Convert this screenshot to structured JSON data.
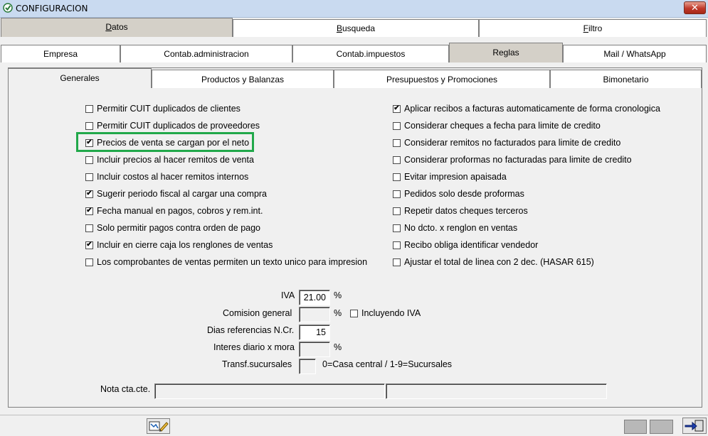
{
  "window": {
    "title": "CONFIGURACION",
    "close_glyph": "✕"
  },
  "tabs_row1": [
    {
      "label": "Datos",
      "accel": "D",
      "rest": "atos",
      "active": true
    },
    {
      "label": "Busqueda",
      "accel": "B",
      "rest": "usqueda",
      "active": false
    },
    {
      "label": "Filtro",
      "accel": "F",
      "rest": "iltro",
      "active": false
    }
  ],
  "tabs_row2": [
    {
      "label": "Empresa",
      "active": false
    },
    {
      "label": "Contab.administracion",
      "active": false
    },
    {
      "label": "Contab.impuestos",
      "active": false
    },
    {
      "label": "Reglas",
      "active": true
    },
    {
      "label": "Mail / WhatsApp",
      "active": false
    }
  ],
  "tabs_row3": [
    {
      "label": "Generales",
      "active": true
    },
    {
      "label": "Productos y Balanzas",
      "active": false
    },
    {
      "label": "Presupuestos y Promociones",
      "active": false
    },
    {
      "label": "Bimonetario",
      "active": false
    }
  ],
  "left_options": [
    {
      "label": "Permitir CUIT duplicados de clientes",
      "checked": false
    },
    {
      "label": "Permitir CUIT duplicados de proveedores",
      "checked": false
    },
    {
      "label": "Precios de venta se cargan por el neto",
      "checked": true
    },
    {
      "label": "Incluir precios al hacer remitos de venta",
      "checked": false
    },
    {
      "label": "Incluir costos al hacer remitos internos",
      "checked": false
    },
    {
      "label": "Sugerir periodo fiscal al cargar una compra",
      "checked": true
    },
    {
      "label": "Fecha manual en pagos, cobros y rem.int.",
      "checked": true
    },
    {
      "label": "Solo permitir pagos contra orden de pago",
      "checked": false
    },
    {
      "label": "Incluir en cierre caja los renglones de ventas",
      "checked": true
    },
    {
      "label": "Los comprobantes de ventas permiten un texto unico para impresion",
      "checked": false
    }
  ],
  "right_options": [
    {
      "label": "Aplicar recibos a facturas automaticamente de forma cronologica",
      "checked": true
    },
    {
      "label": "Considerar cheques a fecha para limite de credito",
      "checked": false
    },
    {
      "label": "Considerar remitos no facturados para limite de credito",
      "checked": false
    },
    {
      "label": "Considerar proformas no facturadas para limite de credito",
      "checked": false
    },
    {
      "label": "Evitar impresion apaisada",
      "checked": false
    },
    {
      "label": "Pedidos solo desde proformas",
      "checked": false
    },
    {
      "label": "Repetir datos cheques terceros",
      "checked": false
    },
    {
      "label": "No dcto. x renglon en ventas",
      "checked": false
    },
    {
      "label": "Recibo obliga identificar vendedor",
      "checked": false
    },
    {
      "label": "Ajustar el total de linea con 2 dec. (HASAR 615)",
      "checked": false
    }
  ],
  "fields": {
    "iva_label": "IVA",
    "iva_value": "21.00",
    "iva_unit": "%",
    "comision_label": "Comision general",
    "comision_value": "",
    "comision_unit": "%",
    "incluyendo_iva_label": "Incluyendo IVA",
    "incluyendo_iva_checked": false,
    "dias_label": "Dias referencias N.Cr.",
    "dias_value": "15",
    "interes_label": "Interes diario x mora",
    "interes_value": "",
    "interes_unit": "%",
    "transf_label": "Transf.sucursales",
    "transf_value": "",
    "transf_hint": "0=Casa central / 1-9=Sucursales",
    "nota_label": "Nota cta.cte.",
    "nota_value_1": "",
    "nota_value_2": ""
  },
  "check_glyph": "✔",
  "colors": {
    "highlight": "#21a84a",
    "active_tab": "#d4d0c8",
    "title_bar": "#c9daf0"
  }
}
